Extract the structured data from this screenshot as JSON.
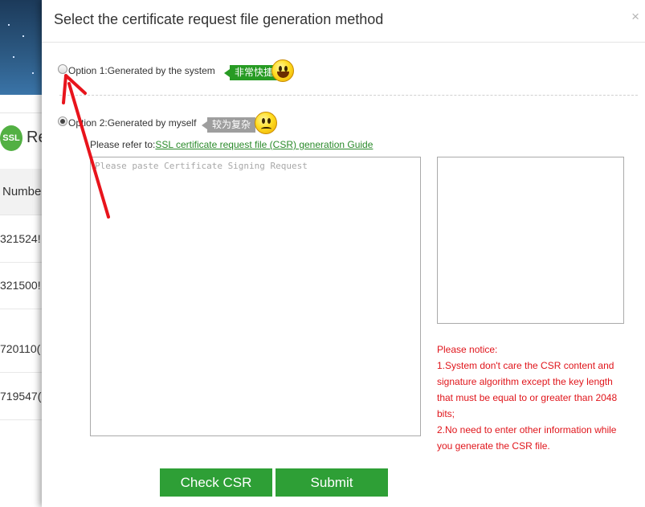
{
  "background": {
    "ssl_badge": "SSL",
    "title_fragment": "Re",
    "table_header": "Numbe",
    "rows": [
      "321524!",
      "321500!",
      "720110(",
      "719547("
    ]
  },
  "modal": {
    "title": "Select the certificate request file generation method",
    "close_icon": "×",
    "option1": {
      "label": "Option 1:Generated by the system",
      "tag": "非常快捷",
      "selected": false
    },
    "option2": {
      "label": "Option 2:Generated by myself",
      "tag": "较为复杂",
      "selected": true
    },
    "refer_prefix": "Please refer to:",
    "refer_link": "SSL certificate request file (CSR) generation Guide",
    "csr_placeholder": "Please paste Certificate Signing Request",
    "notice": {
      "heading": "Please notice:",
      "line1": "1.System don't care the CSR content and signature algorithm except the key length that must be equal to or greater than 2048 bits;",
      "line2": "2.No need to enter other information while you generate the CSR file."
    },
    "buttons": {
      "check": "Check CSR",
      "submit": "Submit"
    }
  },
  "colors": {
    "accent_green": "#2e9f36",
    "tag_green": "#279b23",
    "notice_red": "#e0151b",
    "annotation_arrow": "#e8141c"
  }
}
